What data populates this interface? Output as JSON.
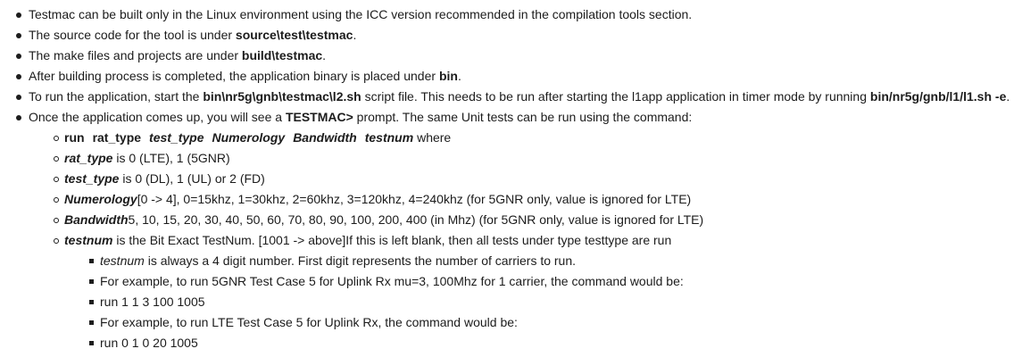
{
  "items": {
    "b1": {
      "text": "Testmac can be built only in the Linux environment using the ICC version recommended in the compilation tools section."
    },
    "b2": {
      "pre": "The source code for the tool is under ",
      "bold": "source\\test\\testmac",
      "post": "."
    },
    "b3": {
      "pre": "The make files and projects are under ",
      "bold": "build\\testmac",
      "post": "."
    },
    "b4": {
      "pre": "After building process is completed, the application binary is placed under ",
      "bold": "bin",
      "post": "."
    },
    "b5": {
      "pre": "To run the application, start the ",
      "bold1": "bin\\nr5g\\gnb\\testmac\\l2.sh",
      "mid": " script file. This needs to be run after starting the l1app application in timer mode by running ",
      "bold2": "bin/nr5g/gnb/l1/l1.sh -e",
      "post": "."
    },
    "b6": {
      "pre": "Once the application comes up, you will see a ",
      "bold": "TESTMAC>",
      "post": " prompt. The same Unit tests can be run using the command:"
    }
  },
  "command": {
    "run": "run",
    "rat_type": "rat_type",
    "test_type": "test_type",
    "numerology": "Numerology",
    "bandwidth": "Bandwidth",
    "testnum": "testnum",
    "where": " where"
  },
  "params": {
    "rat_type": {
      "name": "rat_type",
      "desc": " is 0 (LTE), 1 (5GNR)"
    },
    "test_type": {
      "name": "test_type",
      "desc": " is 0 (DL), 1 (UL) or 2 (FD)"
    },
    "numerology": {
      "name": "Numerology",
      "desc": "[0 -> 4], 0=15khz, 1=30khz, 2=60khz, 3=120khz, 4=240khz (for 5GNR only, value is ignored for LTE)"
    },
    "bandwidth": {
      "name": "Bandwidth",
      "desc": "5, 10, 15, 20, 30, 40, 50, 60, 70, 80, 90, 100, 200, 400 (in Mhz) (for 5GNR only, value is ignored for LTE)"
    },
    "testnum": {
      "name": "testnum",
      "desc": " is the Bit Exact TestNum. [1001 -> above]If this is left blank, then all tests under type testtype are run"
    }
  },
  "notes": {
    "n1": {
      "name": "testnum",
      "desc": " is always a 4 digit number. First digit represents the number of carriers to run."
    },
    "n2": {
      "text": "For example, to run 5GNR Test Case 5 for Uplink Rx mu=3, 100Mhz for 1 carrier, the command would be:"
    },
    "n3": {
      "text": "run 1 1 3 100 1005"
    },
    "n4": {
      "text": "For example, to run LTE Test Case 5 for Uplink Rx, the command would be:"
    },
    "n5": {
      "text": "run 0 1 0 20 1005"
    }
  }
}
